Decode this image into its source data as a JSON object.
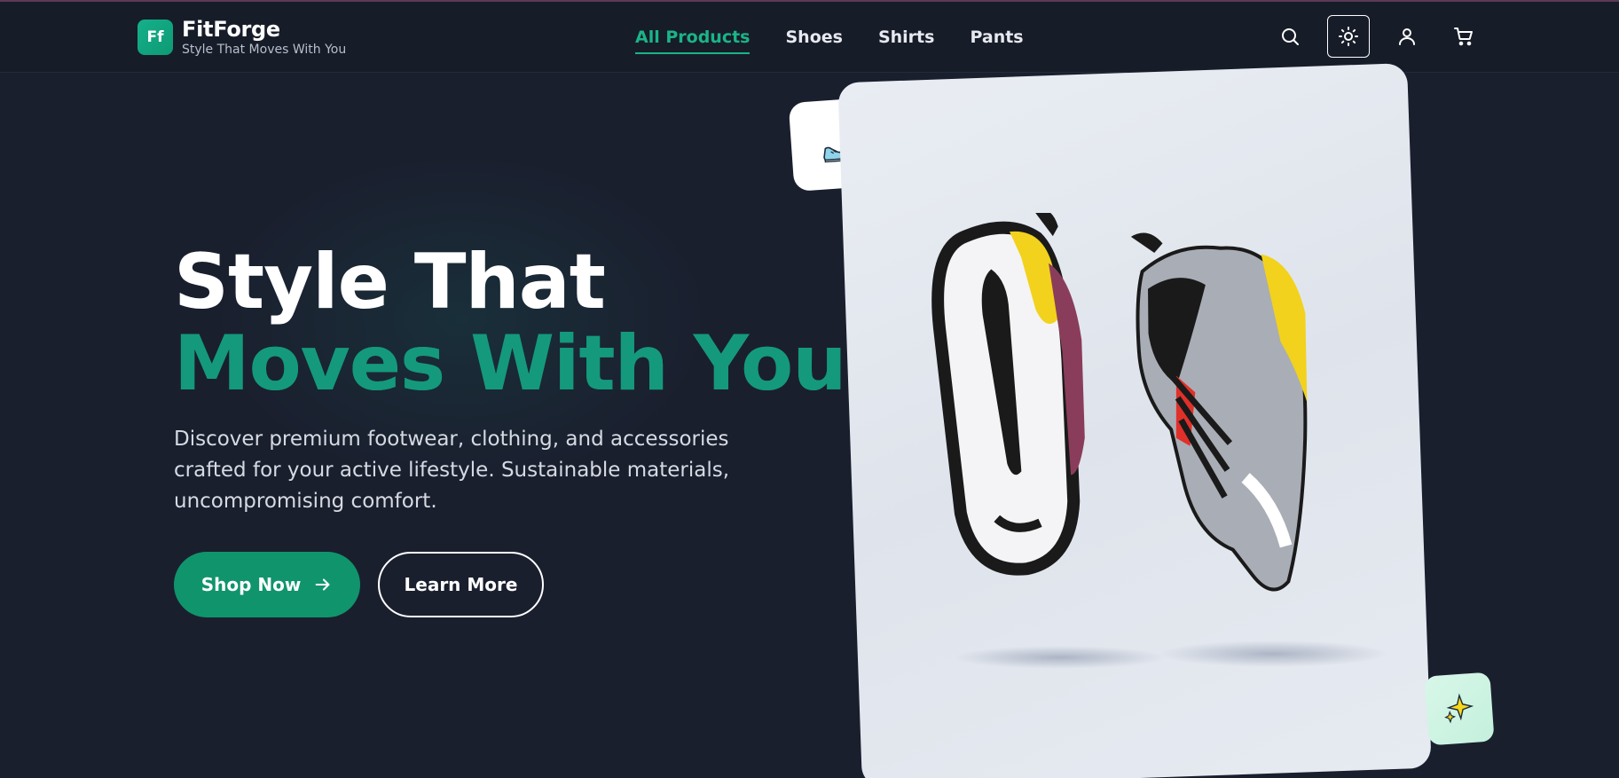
{
  "brand": {
    "logo_text": "Ff",
    "name": "FitForge",
    "tagline": "Style That Moves With You",
    "accent_color": "#10946c"
  },
  "nav": {
    "links": [
      {
        "label": "All Products",
        "active": true
      },
      {
        "label": "Shoes",
        "active": false
      },
      {
        "label": "Shirts",
        "active": false
      },
      {
        "label": "Pants",
        "active": false
      }
    ],
    "icons": [
      "search-icon",
      "sun-icon",
      "user-icon",
      "cart-icon"
    ]
  },
  "hero": {
    "title_line1": "Style That",
    "title_line2": "Moves With You",
    "description": "Discover premium footwear, clothing, and accessories crafted for your active lifestyle. Sustainable materials, uncompromising comfort.",
    "primary_button": "Shop Now",
    "secondary_button": "Learn More"
  },
  "decor": {
    "float_card_icon": "sneaker-icon",
    "sparkle_card_icon": "sparkles-icon",
    "product_image": "floating-sneakers-image"
  }
}
